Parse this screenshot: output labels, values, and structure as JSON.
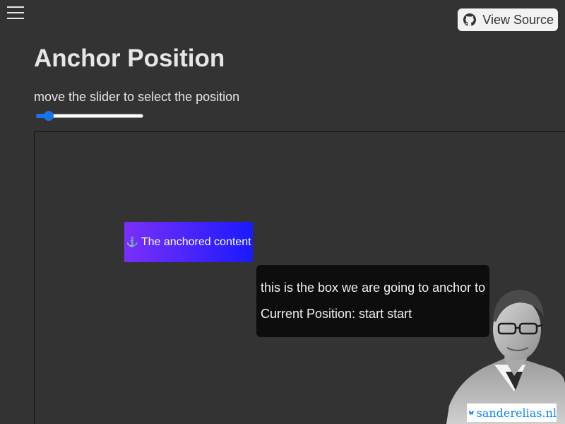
{
  "header": {
    "menu_icon": "hamburger-menu-icon",
    "view_source_label": "View Source",
    "view_source_icon": "github-icon"
  },
  "main": {
    "title": "Anchor Position",
    "instruction": "move the slider to select the position",
    "slider_value_fraction": 0.12
  },
  "demo": {
    "anchored_icon": "⚓",
    "anchored_text": "The anchored content",
    "anchor_box_text": "this is the box we are going to anchor to",
    "current_position_text": "Current Position: start start"
  },
  "footer": {
    "site_name": "sanderelias.nl",
    "site_icon": "bluesky-butterfly-icon"
  },
  "colors": {
    "background": "#333333",
    "accent": "#1a73e8",
    "anchored_gradient_start": "#7b2ff7",
    "anchored_gradient_end": "#1a1aff",
    "anchor_box": "#0d0d0d",
    "site_link": "#1185fe"
  }
}
